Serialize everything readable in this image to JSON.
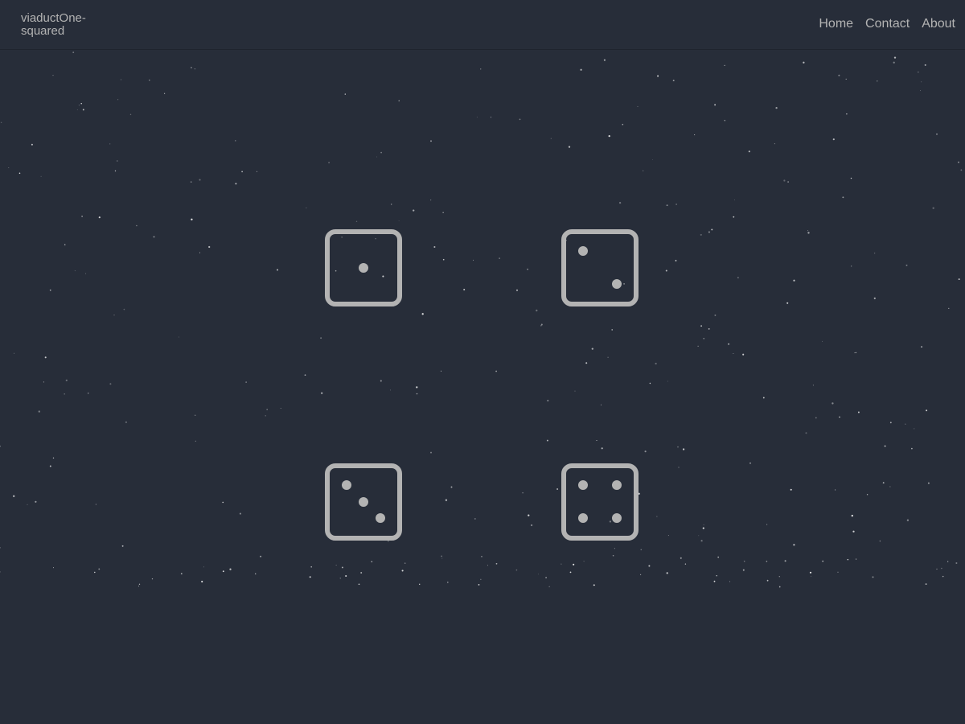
{
  "brand": {
    "line1": "viaductOne-",
    "line2": "squared"
  },
  "nav": {
    "links": [
      "Home",
      "Contact",
      "About"
    ]
  },
  "dice": [
    {
      "value": 1,
      "icon": "die-one-icon"
    },
    {
      "value": 2,
      "icon": "die-two-icon"
    },
    {
      "value": 3,
      "icon": "die-three-icon"
    },
    {
      "value": 4,
      "icon": "die-four-icon"
    }
  ],
  "colors": {
    "background": "#272d39",
    "foreground": "#b3b3b3",
    "stars": "#ffffff"
  }
}
